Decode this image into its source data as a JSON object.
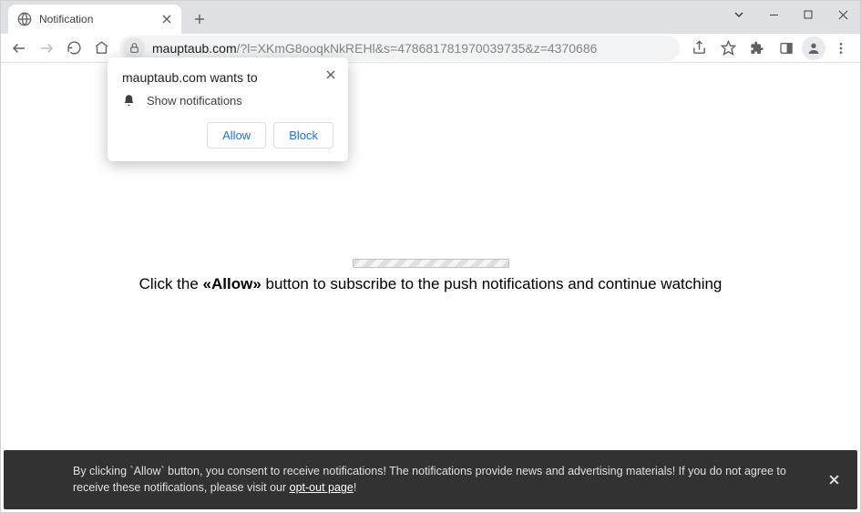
{
  "window": {
    "tab_title": "Notification"
  },
  "omnibox": {
    "domain": "mauptaub.com",
    "path": "/?l=XKmG8ooqkNkREHl&s=478681781970039735&z=4370686"
  },
  "permission_prompt": {
    "title": "mauptaub.com wants to",
    "body": "Show notifications",
    "allow": "Allow",
    "block": "Block"
  },
  "page_content": {
    "instruction_pre": "Click the ",
    "instruction_bold": "«Allow»",
    "instruction_post": " button to subscribe to the push notifications and continue watching"
  },
  "consent": {
    "text_pre": "By clicking `Allow` button, you consent to receive notifications! The notifications provide news and advertising materials! If you do not agree to receive these notifications, please visit our ",
    "link": "opt-out page",
    "text_post": "!"
  }
}
